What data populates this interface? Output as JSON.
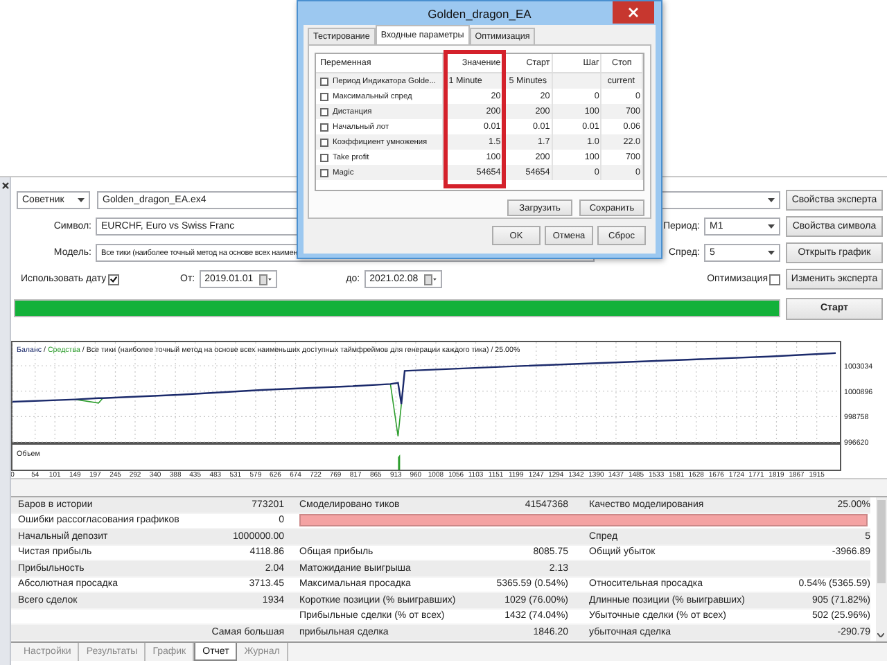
{
  "dialog": {
    "title": "Golden_dragon_EA",
    "tabs": [
      {
        "label": "Тестирование",
        "selected": false
      },
      {
        "label": "Входные параметры",
        "selected": true
      },
      {
        "label": "Оптимизация",
        "selected": false
      }
    ],
    "columns": [
      "Переменная",
      "Значение",
      "Старт",
      "Шаг",
      "Стоп"
    ],
    "params": [
      {
        "checked": false,
        "name": "Период Индикатора Golde...",
        "value": "1 Minute",
        "start": "5 Minutes",
        "stop": "current"
      },
      {
        "checked": false,
        "name": "Максимальный спред",
        "value": "20",
        "start": "20",
        "step": "0",
        "stop": "0"
      },
      {
        "checked": false,
        "name": "Дистанция",
        "value": "200",
        "start": "200",
        "step": "100",
        "stop": "700"
      },
      {
        "checked": false,
        "name": "Начальный лот",
        "value": "0.01",
        "start": "0.01",
        "step": "0.01",
        "stop": "0.06"
      },
      {
        "checked": false,
        "name": "Коэффициент умножения",
        "value": "1.5",
        "start": "1.7",
        "step": "1.0",
        "stop": "22.0"
      },
      {
        "checked": false,
        "name": "Take profit",
        "value": "100",
        "start": "200",
        "step": "100",
        "stop": "700"
      },
      {
        "checked": false,
        "name": "Magic",
        "value": "54654",
        "start": "54654",
        "step": "0",
        "stop": "0"
      }
    ],
    "buttons_top": [
      "Загрузить",
      "Сохранить"
    ],
    "buttons_bottom": [
      "OK",
      "Отмена",
      "Сброс"
    ]
  },
  "tester": {
    "expert_type": "Советник",
    "expert": "Golden_dragon_EA.ex4",
    "symbol_label": "Символ:",
    "symbol": "EURCHF, Euro vs Swiss Franc",
    "period_label": "Период:",
    "period": "M1",
    "model_label": "Модель:",
    "model": "Все тики (наиболее точный метод на основе всех наимен",
    "spread_label": "Спред:",
    "spread": "5",
    "use_date": {
      "label": "Использовать дату",
      "checked": true
    },
    "from_label": "От:",
    "from": "2019.01.01",
    "to_label": "до:",
    "to": "2021.02.08",
    "optimization": {
      "label": "Оптимизация",
      "checked": false
    },
    "progress": {
      "level": 1.0
    },
    "buttons": [
      "Свойства эксперта",
      "Свойства символа",
      "Открыть график",
      "Изменить эксперта"
    ],
    "start_button": "Старт"
  },
  "chart": {
    "separator": "/",
    "caption": "/ Все тики (наиболее точный метод на основе всех наименьших доступных таймфреймов для генерации каждого тика) / 25.00%",
    "volume_label": "Объем",
    "chart_data": {
      "type": "line",
      "x": [
        0,
        150,
        205,
        215,
        400,
        600,
        800,
        900,
        918,
        926,
        934,
        1200,
        1500,
        1800,
        1960
      ],
      "series": [
        {
          "name": "Баланс",
          "color": "#1b2a6b",
          "values": [
            1000000,
            1000200,
            1000300,
            1000300,
            1000600,
            1001000,
            1001300,
            1001500,
            1001600,
            999800,
            1002600,
            1003000,
            1003400,
            1003800,
            1004100
          ]
        },
        {
          "name": "Средства",
          "color": "#2e9e2e",
          "values": [
            null,
            1000200,
            999900,
            1000300,
            null,
            null,
            null,
            1001500,
            997100,
            999800,
            null,
            null,
            null,
            null,
            null
          ]
        }
      ],
      "grid": true,
      "xlim": [
        0,
        1970
      ],
      "ylim": [
        996620,
        1005016
      ],
      "xticks": [
        0,
        54,
        101,
        149,
        197,
        245,
        292,
        340,
        388,
        435,
        483,
        531,
        579,
        626,
        674,
        722,
        769,
        817,
        865,
        913,
        960,
        1008,
        1056,
        1103,
        1151,
        1199,
        1247,
        1294,
        1342,
        1390,
        1437,
        1485,
        1533,
        1581,
        1628,
        1676,
        1724,
        1771,
        1819,
        1867,
        1915
      ],
      "yticks": [
        996620,
        998758,
        1000896,
        1003034
      ]
    }
  },
  "report": {
    "rows": [
      {
        "kind": "text",
        "cells": [
          "Баров в истории",
          "773201",
          "Смоделировано тиков",
          "41547368",
          "Качество моделирования",
          "25.00%"
        ]
      },
      {
        "kind": "bar",
        "cells": [
          "Ошибки рассогласования графиков",
          "0"
        ]
      },
      {
        "kind": "text",
        "cells": [
          "Начальный депозит",
          "1000000.00",
          null,
          null,
          "Спред",
          "5"
        ]
      },
      {
        "kind": "text",
        "cells": [
          "Чистая прибыль",
          "4118.86",
          "Общая прибыль",
          "8085.75",
          "Общий убыток",
          "-3966.89"
        ]
      },
      {
        "kind": "text",
        "cells": [
          "Прибыльность",
          "2.04",
          "Матожидание выигрыша",
          "2.13",
          null,
          null
        ]
      },
      {
        "kind": "text",
        "cells": [
          "Абсолютная просадка",
          "3713.45",
          "Максимальная просадка",
          "5365.59 (0.54%)",
          "Относительная просадка",
          "0.54% (5365.59)"
        ]
      },
      {
        "kind": "text",
        "cells": [
          "Всего сделок",
          "1934",
          "Короткие позиции (% выигравших)",
          "1029 (76.00%)",
          "Длинные позиции (% выигравших)",
          "905 (71.82%)"
        ]
      },
      {
        "kind": "text",
        "cells": [
          null,
          null,
          "Прибыльные сделки (% от всех)",
          "1432 (74.04%)",
          "Убыточные сделки (% от всех)",
          "502 (25.96%)"
        ]
      },
      {
        "kind": "text",
        "cells": [
          null,
          "Самая большая",
          "прибыльная сделка",
          "1846.20",
          "убыточная сделка",
          "-290.79"
        ]
      }
    ]
  },
  "tabs": [
    {
      "label": "Настройки",
      "selected": false
    },
    {
      "label": "Результаты",
      "selected": false
    },
    {
      "label": "График",
      "selected": false
    },
    {
      "label": "Отчет",
      "selected": true
    },
    {
      "label": "Журнал",
      "selected": false
    }
  ]
}
